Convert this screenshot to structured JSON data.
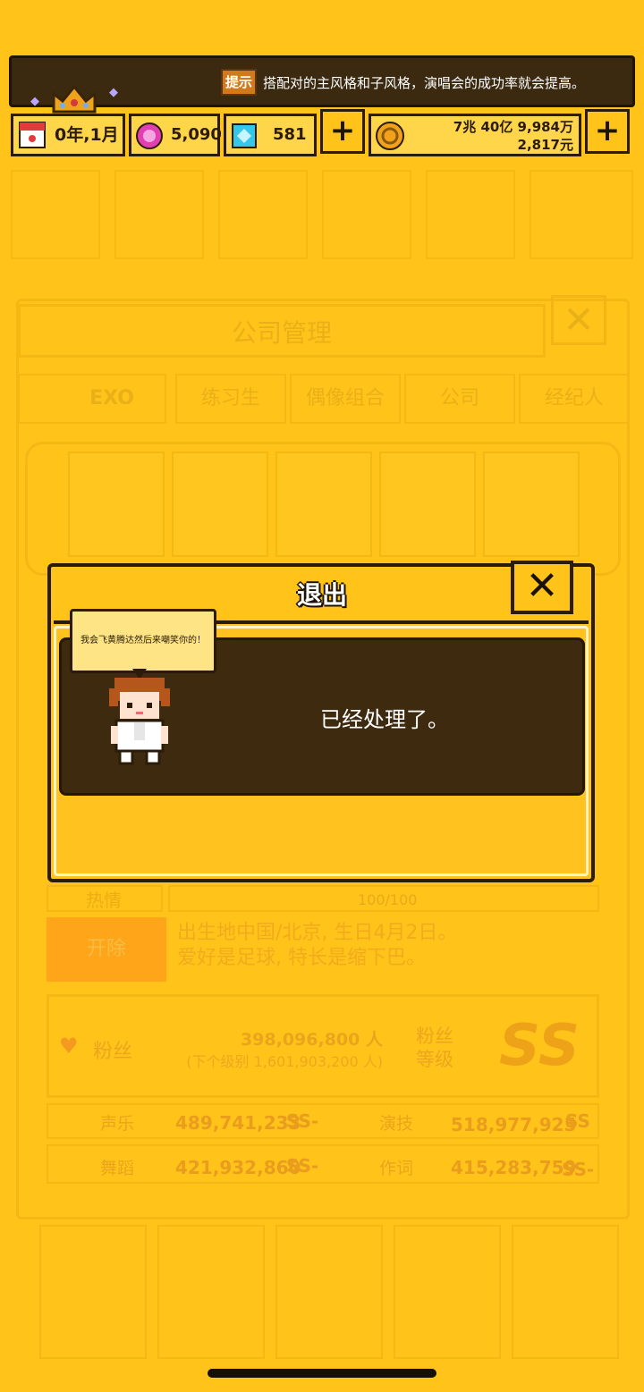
{
  "hud": {
    "hint_icon": "提示",
    "hint_text": "搭配对的主风格和子风格，演唱会的成功率就会提高。",
    "date": "0年,1月",
    "gems_pink": "5,090",
    "gems_blue": "581",
    "money_line1": "7兆 40亿 9,984万",
    "money_line2": "2,817元",
    "plus": "+"
  },
  "background": {
    "title": "公司管理",
    "close": "✕",
    "tabs": [
      "EXO",
      "练习生",
      "偶像组合",
      "公司",
      "经纪人"
    ],
    "passion_label": "热情",
    "passion_value": "100/100",
    "fire_button": "开除",
    "desc_line1": "出生地中国/北京, 生日4月2日。",
    "desc_line2": "爱好是足球, 特长是缩下巴。",
    "fans_label": "粉丝",
    "fans_count": "398,096,800 人",
    "fans_next": "(下个级别 1,601,903,200 人)",
    "fan_level_label": "粉丝等级",
    "fan_level_grade": "SS",
    "stats": [
      {
        "name": "声乐",
        "value": "489,741,233",
        "grade": "SS-"
      },
      {
        "name": "演技",
        "value": "518,977,925",
        "grade": "SS"
      },
      {
        "name": "舞蹈",
        "value": "421,932,860",
        "grade": "SS-"
      },
      {
        "name": "作词",
        "value": "415,283,759",
        "grade": "SS-"
      }
    ]
  },
  "dialog": {
    "title": "退出",
    "close": "✕",
    "bubble": "我会飞黄腾达然后来嘲笑你的！",
    "message": "已经处理了。"
  },
  "colors": {
    "background": "#FFC31A",
    "dark_brown": "#3e2b0f",
    "outline": "#2a1c08"
  }
}
